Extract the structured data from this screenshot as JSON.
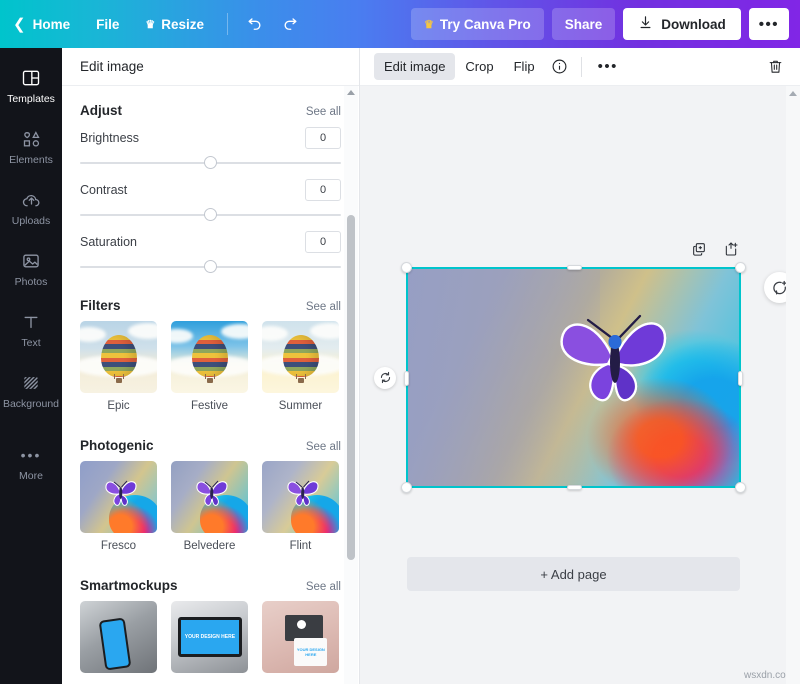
{
  "topbar": {
    "back_label": "Home",
    "file_label": "File",
    "resize_label": "Resize",
    "try_pro_label": "Try Canva Pro",
    "share_label": "Share",
    "download_label": "Download",
    "more_label": "•••",
    "crown_glyph": "♛",
    "gradient_start": "#00c4cc",
    "gradient_end": "#8126e6"
  },
  "rail": {
    "items": [
      {
        "label": "Templates",
        "icon": "templates-icon",
        "active": true
      },
      {
        "label": "Elements",
        "icon": "elements-icon",
        "active": false
      },
      {
        "label": "Uploads",
        "icon": "uploads-icon",
        "active": false
      },
      {
        "label": "Photos",
        "icon": "photos-icon",
        "active": false
      },
      {
        "label": "Text",
        "icon": "text-icon",
        "active": false
      },
      {
        "label": "Background",
        "icon": "background-icon",
        "active": false
      },
      {
        "label": "More",
        "icon": "more-dots-icon",
        "active": false
      }
    ]
  },
  "panel": {
    "title": "Edit image",
    "see_all_label": "See all",
    "adjust": {
      "title": "Adjust",
      "sliders": [
        {
          "label": "Brightness",
          "value": "0"
        },
        {
          "label": "Contrast",
          "value": "0"
        },
        {
          "label": "Saturation",
          "value": "0"
        }
      ]
    },
    "filters": {
      "title": "Filters",
      "items": [
        {
          "label": "Epic"
        },
        {
          "label": "Festive"
        },
        {
          "label": "Summer"
        }
      ]
    },
    "photogenic": {
      "title": "Photogenic",
      "items": [
        {
          "label": "Fresco"
        },
        {
          "label": "Belvedere"
        },
        {
          "label": "Flint"
        }
      ]
    },
    "smartmockups": {
      "title": "Smartmockups",
      "mockup_laptop_text": "YOUR DESIGN HERE",
      "mockup_card_text": "YOUR DESIGN HERE"
    }
  },
  "editor": {
    "toolbar": {
      "edit_image_label": "Edit image",
      "crop_label": "Crop",
      "flip_label": "Flip",
      "info_icon": "info-circle-icon",
      "more_label": "•••",
      "trash_icon": "trash-icon"
    },
    "canvas": {
      "add_page_label": "+ Add page",
      "selection_color": "#00c4cc",
      "duplicate_icon": "duplicate-page-icon",
      "add_page_icon": "add-page-icon",
      "comment_icon": "comment-icon",
      "rotate_icon": "rotate-icon"
    }
  },
  "watermark": "wsxdn.com"
}
